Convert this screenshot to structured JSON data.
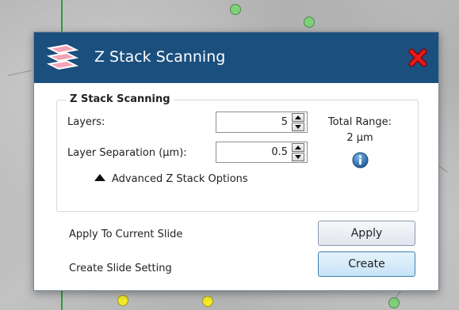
{
  "dialog": {
    "title": "Z Stack Scanning",
    "icon": "stacked-layers-icon",
    "close_icon": "red-x-close-icon",
    "title_bar_color": "#1a4f7e"
  },
  "group": {
    "title": "Z Stack Scanning",
    "layers_label": "Layers:",
    "layers_value": "5",
    "separation_label": "Layer Separation (µm):",
    "separation_value": "0.5",
    "total_range_label": "Total Range:",
    "total_range_value": "2 µm",
    "info_icon": "info-icon",
    "advanced_label": "Advanced Z Stack Options"
  },
  "actions": {
    "apply_text": "Apply To Current Slide",
    "apply_button": "Apply",
    "create_text": "Create Slide Setting",
    "create_button": "Create"
  },
  "colors": {
    "accent": "#1a4f7e",
    "create_button_bg": "#c7e3f6",
    "background_line": "#2e9d3a",
    "dot_green": "#7fd07a",
    "dot_yellow": "#f2ea2a"
  }
}
